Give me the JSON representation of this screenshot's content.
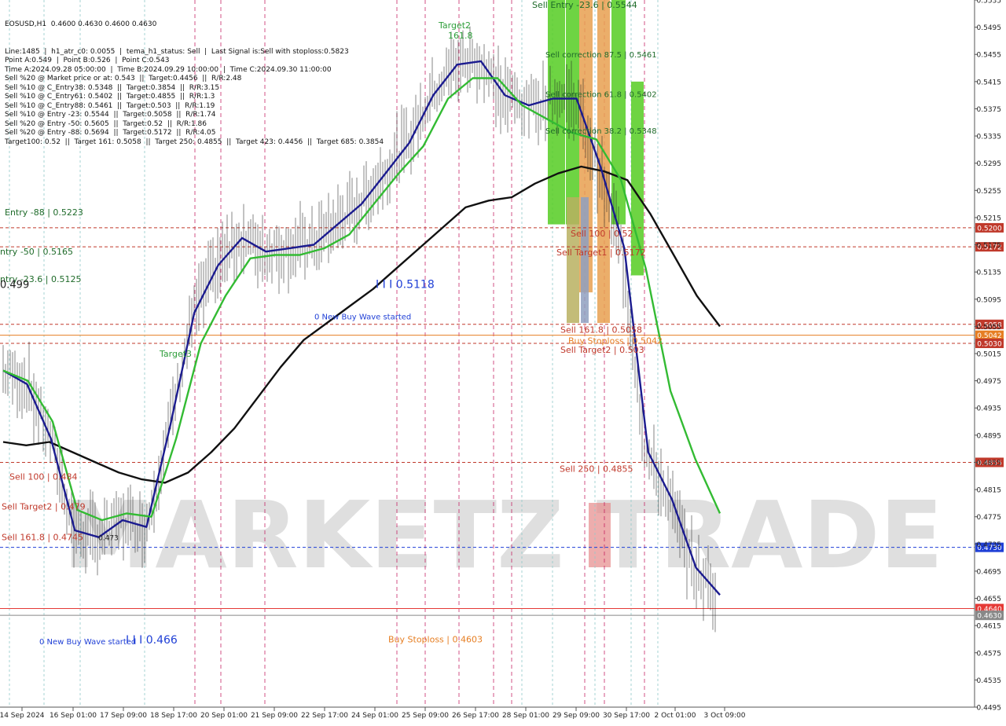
{
  "chart_data": {
    "type": "line",
    "title": "EOSUSD,H1  0.4600 0.4630 0.4600 0.4630",
    "info_lines": [
      "Line:1485  |  h1_atr_c0: 0.0055  |  tema_h1_status: Sell  |  Last Signal is:Sell with stoploss:0.5823",
      "Point A:0.549  |  Point B:0.526  |  Point C:0.543",
      "Time A:2024.09.28 05:00:00  |  Time B:2024.09.29 10:00:00  |  Time C:2024.09.30 11:00:00",
      "Sell %20 @ Market price or at: 0.543  ||  Target:0.4456  ||  R/R:2.48",
      "Sell %10 @ C_Entry38: 0.5348  ||  Target:0.3854  ||  R/R:3.15",
      "Sell %10 @ C_Entry61: 0.5402  ||  Target:0.4855  ||  R/R:1.3",
      "Sell %10 @ C_Entry88: 0.5461  ||  Target:0.503  ||  R/R:1.19",
      "Sell %10 @ Entry -23: 0.5544  ||  Target:0.5058  ||  R/R:1.74",
      "Sell %20 @ Entry -50: 0.5605  ||  Target:0.52  ||  R/R:1.86",
      "Sell %20 @ Entry -88: 0.5694  ||  Target:0.5172  ||  R/R:4.05",
      "Target100: 0.52  ||  Target 161: 0.5058  ||  Target 250: 0.4855  ||  Target 423: 0.4456  ||  Target 685: 0.3854"
    ],
    "watermark": "MARKETZ TRADE",
    "ylim": [
      0.4495,
      0.5535
    ],
    "y_ticks": [
      0.5535,
      0.5495,
      0.5455,
      0.5415,
      0.5375,
      0.5335,
      0.5295,
      0.5255,
      0.5215,
      0.5175,
      0.5135,
      0.5095,
      0.5055,
      0.5015,
      0.4975,
      0.4935,
      0.4895,
      0.4855,
      0.4815,
      0.4775,
      0.4735,
      0.4695,
      0.4655,
      0.4615,
      0.4575,
      0.4535,
      0.4495
    ],
    "x_labels": [
      "14 Sep 2024",
      "16 Sep 01:00",
      "17 Sep 09:00",
      "18 Sep 17:00",
      "20 Sep 01:00",
      "21 Sep 09:00",
      "22 Sep 17:00",
      "24 Sep 01:00",
      "25 Sep 09:00",
      "26 Sep 17:00",
      "28 Sep 01:00",
      "29 Sep 09:00",
      "30 Sep 17:00",
      "2 Oct 01:00",
      "3 Oct 09:00"
    ],
    "horizontal_levels": [
      {
        "value": 0.52,
        "label": "0.5200",
        "color": "#c0392b",
        "style": "dashed"
      },
      {
        "value": 0.5172,
        "label": "0.5172",
        "color": "#c0392b",
        "style": "dashed"
      },
      {
        "value": 0.5058,
        "label": "0.5058",
        "color": "#c0392b",
        "style": "dashed"
      },
      {
        "value": 0.5042,
        "label": "0.5042",
        "color": "#e67e22",
        "style": "solid"
      },
      {
        "value": 0.503,
        "label": "0.5030",
        "color": "#c0392b",
        "style": "dashed"
      },
      {
        "value": 0.4855,
        "label": "0.4855",
        "color": "#c0392b",
        "style": "dashed"
      },
      {
        "value": 0.473,
        "label": "0.4730",
        "color": "#1f3fd6",
        "style": "dashed"
      },
      {
        "value": 0.464,
        "label": "0.4640",
        "color": "#e53935",
        "style": "solid"
      },
      {
        "value": 0.463,
        "label": "0.4630",
        "color": "#888888",
        "style": "solid"
      }
    ],
    "level_labels": [
      {
        "text": "Entry -88 | 0.5223",
        "value": 0.5223,
        "color": "#1f6b2a"
      },
      {
        "text": "ntry -50 | 0.5165",
        "value": 0.5165,
        "color": "#1f6b2a"
      },
      {
        "text": "ntry -23.6 | 0.5125",
        "value": 0.5125,
        "color": "#1f6b2a"
      },
      {
        "text": "0.499",
        "value": 0.5116,
        "color": "#222222"
      },
      {
        "text": "Sell 100 | 0.484",
        "value": 0.4834,
        "color": "#c0392b"
      },
      {
        "text": "Sell Target2 | 0.479",
        "value": 0.479,
        "color": "#c0392b"
      },
      {
        "text": "Sell 161.8 | 0.4745",
        "value": 0.4745,
        "color": "#c0392b"
      },
      {
        "text": "0.473",
        "value": 0.4745,
        "color": "#222222"
      },
      {
        "text": "Sell 100 | 0.52",
        "value": 0.5192,
        "color": "#c0392b"
      },
      {
        "text": "Sell Target1 | 0.5172",
        "value": 0.5164,
        "color": "#c0392b"
      },
      {
        "text": "Sell 161.8 | 0.5058",
        "value": 0.505,
        "color": "#c0392b"
      },
      {
        "text": "Buy Stoploss | 0.5042",
        "value": 0.5034,
        "color": "#e67e22"
      },
      {
        "text": "Sell Target2 | 0.503",
        "value": 0.5021,
        "color": "#c0392b"
      },
      {
        "text": "Sell 250 | 0.4855",
        "value": 0.4846,
        "color": "#c0392b"
      },
      {
        "text": "Buy Stoploss | 0.4603",
        "value": 0.4595,
        "color": "#e67e22"
      },
      {
        "text": "Sell Entry -23.6 | 0.5544",
        "value": 0.5528,
        "color": "#1f6b2a"
      },
      {
        "text": "Sell correction 87.5 | 0.5461",
        "value": 0.5455,
        "color": "#1f6b2a"
      },
      {
        "text": "Sell correction 61.8 | 0.5402",
        "value": 0.5397,
        "color": "#1f6b2a"
      },
      {
        "text": "Sell correction 38.2 | 0.5348",
        "value": 0.5343,
        "color": "#1f6b2a"
      },
      {
        "text": "0 New Buy Wave started",
        "value": 0.507,
        "color": "#1f3fd6"
      },
      {
        "text": "0 New Buy Wave started",
        "value": 0.4592,
        "color": "#1f3fd6"
      },
      {
        "text": "I I I 0.5118",
        "value": 0.5116,
        "color": "#1f3fd6"
      },
      {
        "text": "I I I 0.466",
        "value": 0.4593,
        "color": "#1f3fd6"
      },
      {
        "text": "Target2",
        "value": 0.5498,
        "color": "#2e9e3a"
      },
      {
        "text": "161.8",
        "value": 0.5483,
        "color": "#2e9e3a"
      },
      {
        "text": "Target3",
        "value": 0.5015,
        "color": "#2e9e3a"
      }
    ],
    "series": [
      {
        "name": "",
        "color": "#111111",
        "values": [
          0.4885,
          0.488,
          0.4885,
          0.487,
          0.4855,
          0.484,
          0.483,
          0.4825,
          0.484,
          0.487,
          0.4905,
          0.495,
          0.4995,
          0.5035,
          0.506,
          0.5085,
          0.511,
          0.514,
          0.517,
          0.52,
          0.523,
          0.524,
          0.5245,
          0.5265,
          0.528,
          0.529,
          0.5283,
          0.527,
          0.522,
          0.516,
          0.51,
          0.5055
        ]
      },
      {
        "name": "",
        "color": "#1b1b8f",
        "values": [
          0.499,
          0.497,
          0.489,
          0.4755,
          0.4745,
          0.477,
          0.476,
          0.491,
          0.5075,
          0.5145,
          0.5185,
          0.5165,
          0.517,
          0.5175,
          0.5205,
          0.5235,
          0.528,
          0.5325,
          0.5395,
          0.544,
          0.5445,
          0.5395,
          0.538,
          0.539,
          0.539,
          0.529,
          0.517,
          0.487,
          0.48,
          0.47,
          0.466
        ]
      },
      {
        "name": "",
        "color": "#33bb33",
        "values": [
          0.499,
          0.4975,
          0.4915,
          0.4785,
          0.477,
          0.478,
          0.4775,
          0.489,
          0.503,
          0.51,
          0.5155,
          0.516,
          0.516,
          0.517,
          0.519,
          0.5235,
          0.528,
          0.532,
          0.539,
          0.542,
          0.542,
          0.538,
          0.536,
          0.534,
          0.533,
          0.527,
          0.514,
          0.496,
          0.486,
          0.478
        ]
      }
    ],
    "current_price": 0.463
  }
}
